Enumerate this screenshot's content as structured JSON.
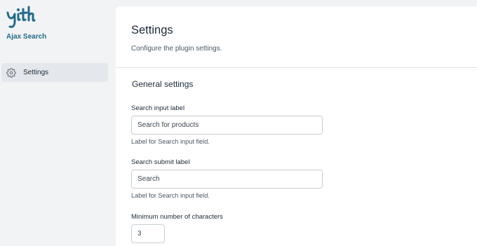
{
  "sidebar": {
    "logo_text": "yith",
    "plugin_name": "Ajax Search",
    "nav": [
      {
        "label": "Settings",
        "icon": "gear-icon"
      }
    ]
  },
  "panel": {
    "title": "Settings",
    "subtitle": "Configure the plugin settings.",
    "section_title": "General settings",
    "fields": [
      {
        "label": "Search input label",
        "value": "Search for products",
        "help": "Label for Search input field."
      },
      {
        "label": "Search submit label",
        "value": "Search",
        "help": "Label for Search input field."
      },
      {
        "label": "Minimum number of characters",
        "value": "3"
      }
    ]
  },
  "colors": {
    "brand": "#246b8a",
    "background": "#f1f3f5",
    "panel": "#ffffff"
  }
}
